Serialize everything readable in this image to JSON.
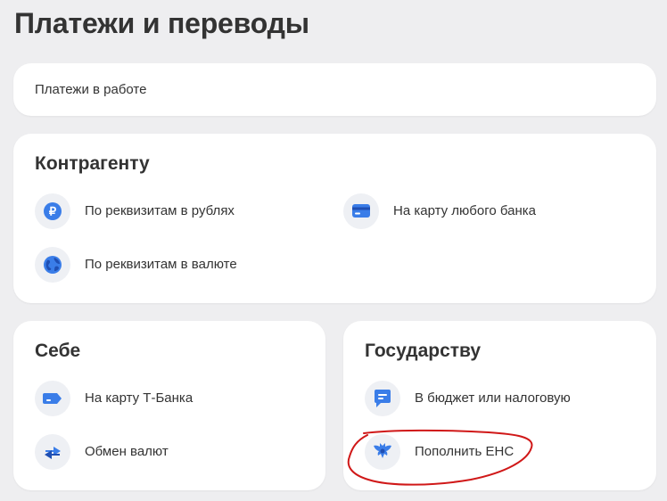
{
  "page": {
    "title": "Платежи и переводы"
  },
  "in_progress": {
    "label": "Платежи в работе"
  },
  "counterparty": {
    "title": "Контрагенту",
    "items": [
      {
        "label": "По реквизитам в рублях",
        "icon": "ruble-icon"
      },
      {
        "label": "На карту любого банка",
        "icon": "card-icon"
      },
      {
        "label": "По реквизитам в валюте",
        "icon": "globe-icon"
      }
    ]
  },
  "self": {
    "title": "Себе",
    "items": [
      {
        "label": "На карту Т-Банка",
        "icon": "t-bank-card-icon"
      },
      {
        "label": "Обмен валют",
        "icon": "exchange-icon"
      }
    ]
  },
  "state": {
    "title": "Государству",
    "items": [
      {
        "label": "В бюджет или налоговую",
        "icon": "tax-document-icon"
      },
      {
        "label": "Пополнить ЕНС",
        "icon": "emblem-icon"
      }
    ]
  },
  "colors": {
    "background": "#eeeef0",
    "card": "#ffffff",
    "text": "#333333",
    "icon_bg": "#eef0f4",
    "accent_blue": "#3a7de8",
    "annotation_red": "#d01818"
  }
}
